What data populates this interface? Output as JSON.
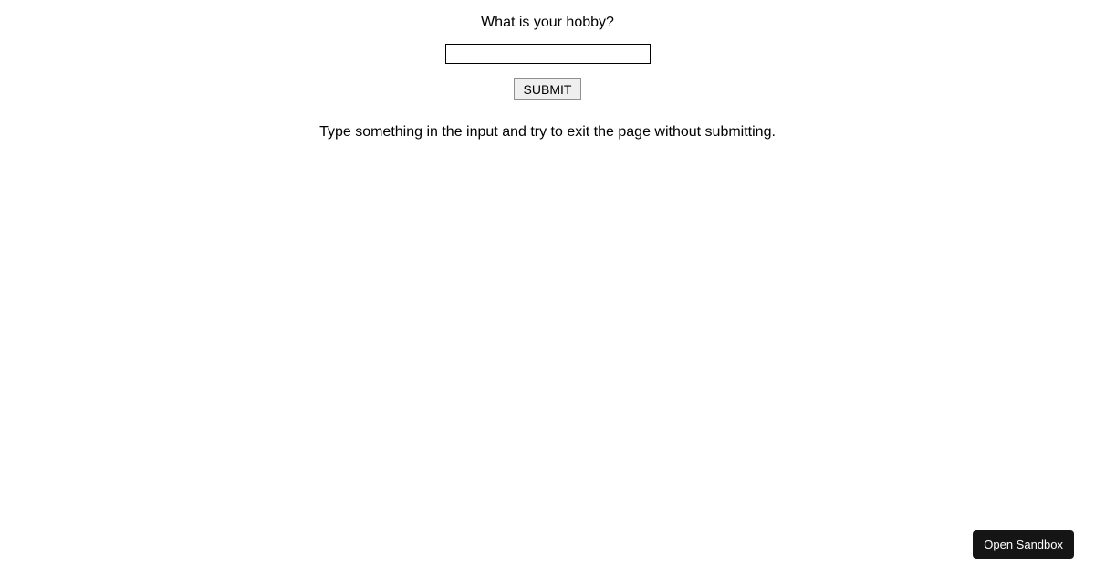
{
  "form": {
    "question": "What is your hobby?",
    "input_value": "",
    "submit_label": "SUBMIT",
    "instruction": "Type something in the input and try to exit the page without submitting."
  },
  "sandbox": {
    "button_label": "Open Sandbox"
  }
}
